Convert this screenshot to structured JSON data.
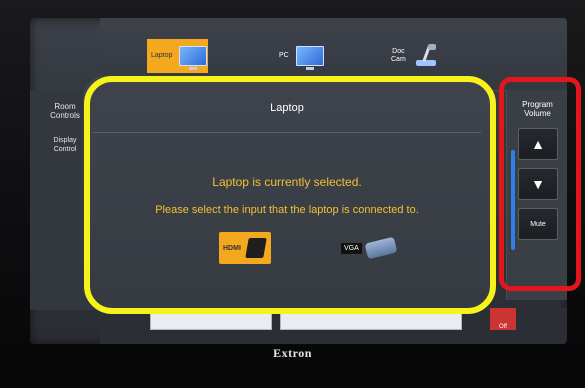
{
  "sources": [
    {
      "label": "Laptop",
      "icon": "laptop-icon",
      "active": true
    },
    {
      "label": "PC",
      "icon": "monitor-icon",
      "active": false
    },
    {
      "label": "Doc\nCam",
      "icon": "doc-camera-icon",
      "active": false
    }
  ],
  "left_menu": {
    "room_controls": "Room\nControls",
    "display_control": "Display\nControl"
  },
  "panel": {
    "title": "Laptop",
    "message_selected": "Laptop is currently selected.",
    "message_instruction": "Please select the input that the laptop is connected to.",
    "inputs": [
      {
        "label": "HDMI",
        "icon": "hdmi-plug-icon"
      },
      {
        "label": "VGA",
        "icon": "vga-plug-icon"
      }
    ]
  },
  "volume": {
    "label": "Program\nVolume",
    "up_symbol": "▲",
    "down_symbol": "▼",
    "mute_label": "Mute"
  },
  "bottom": {
    "off_label": "Off"
  },
  "brand": "Extron",
  "colors": {
    "accent": "#f4a81d",
    "message_text": "#f1c033",
    "highlight_yellow": "#f7f21a",
    "highlight_red": "#e3161b",
    "volume_bar": "#2f7fe8"
  }
}
